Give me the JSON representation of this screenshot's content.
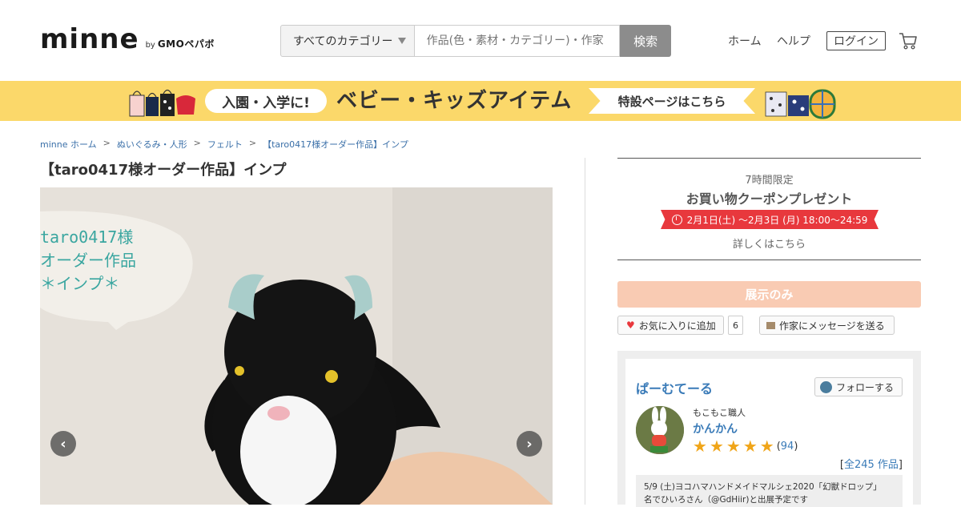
{
  "header": {
    "logo": "minne",
    "logo_by": "by",
    "logo_company": "GMOペパボ",
    "search": {
      "category": "すべてのカテゴリー",
      "placeholder": "作品(色・素材・カテゴリー)・作家",
      "button": "検索"
    },
    "nav": {
      "home": "ホーム",
      "help": "ヘルプ",
      "login": "ログイン",
      "cart_icon": "cart-icon"
    }
  },
  "banner": {
    "pill": "入園・入学に!",
    "main": "ベビー・キッズアイテム",
    "tag": "特設ページはこちら",
    "bg_color": "#fbd86a"
  },
  "breadcrumb": {
    "items": [
      "minne ホーム",
      "ぬいぐるみ・人形",
      "フェルト",
      "【taro0417様オーダー作品】インプ"
    ],
    "separator": ">"
  },
  "item": {
    "title": "【taro0417様オーダー作品】インプ",
    "photo_caption": [
      "taro0417様",
      "オーダー作品",
      "＊インプ＊"
    ],
    "prev": "‹",
    "next": "›"
  },
  "coupon": {
    "limit": "7時間限定",
    "title": "お買い物クーポンプレゼント",
    "date": "2月1日(土) 〜2月3日 (月) 18:00〜24:59",
    "detail": "詳しくはこちら",
    "accent": "#e8383d"
  },
  "actions": {
    "exhibit_only": "展示のみ",
    "favorite": "お気に入りに追加",
    "favorite_count": "6",
    "message": "作家にメッセージを送る"
  },
  "seller": {
    "shop_name": "ぱーむてーる",
    "follow": "フォローする",
    "artisan_title": "もこもこ職人",
    "artisan_name": "かんかん",
    "rating": 5,
    "review_count_text": "94",
    "all_works_prefix": "[",
    "all_works": "全245 作品",
    "all_works_suffix": "]",
    "notice_line1": "5/9 (土)ヨコハマハンドメイドマルシェ2020「幻獣ドロップ」",
    "notice_line2": "名でひいろさん（@GdHiir)と出展予定です"
  }
}
